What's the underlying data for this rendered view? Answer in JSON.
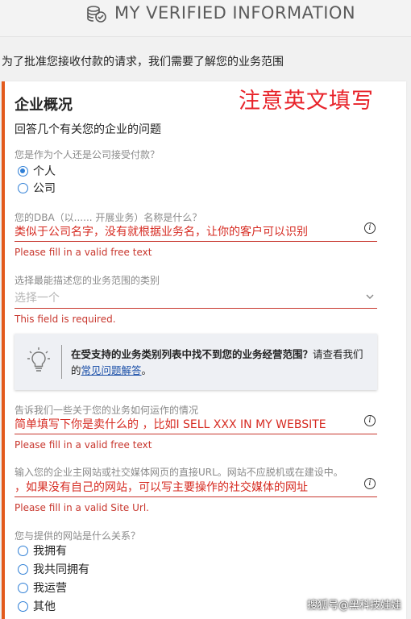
{
  "header": {
    "title": "MY VERIFIED INFORMATION",
    "icon": "coins-check-icon"
  },
  "intro": "为了批准您接收付款的请求，我们需要了解您的业务范围",
  "card": {
    "title": "企业概况",
    "annotation": "注意英文填写",
    "subtitle": "回答几个有关您的企业的问题",
    "q1": {
      "label": "您是作为个人还是公司接受付款？",
      "options": [
        "个人",
        "公司"
      ],
      "selected": "个人"
    },
    "q2": {
      "label": "您的DBA（以...... 开展业务）名称是什么？",
      "value": "类似于公司名字，没有就根据业务名，让你的客户可以识别",
      "error": "Please fill in a valid free text"
    },
    "q3": {
      "label": "选择最能描述您的业务范围的类别",
      "placeholder": "选择一个",
      "error": "This field is required."
    },
    "tip": {
      "bold": "在受支持的业务类别列表中找不到您的业务经营范围？",
      "text": "请查看我们的",
      "link": "常见问题解答",
      "end": "。"
    },
    "q4": {
      "label": "告诉我们一些关于您的业务如何运作的情况",
      "value": "简单填写下你是卖什么的 ，比如I SELL XXX  IN MY WEBSITE",
      "error": "Please fill in a valid free text"
    },
    "q5": {
      "label": "输入您的企业主网站或社交媒体网页的直接URL。网站不应脱机或在建设中。",
      "value": "，如果没有自己的网站，可以写主要操作的社交媒体的网址",
      "error": "Please fill in a valid Site Url."
    },
    "q6": {
      "label": "您与提供的网站是什么关系？",
      "options": [
        "我拥有",
        "我共同拥有",
        "我运营",
        "其他"
      ]
    }
  },
  "watermark": "搜狐号@黑科技娃娃",
  "colors": {
    "accent": "#e35a1c",
    "error": "#c8372e",
    "radio": "#2f7fd6",
    "link": "#1a4fa8"
  }
}
